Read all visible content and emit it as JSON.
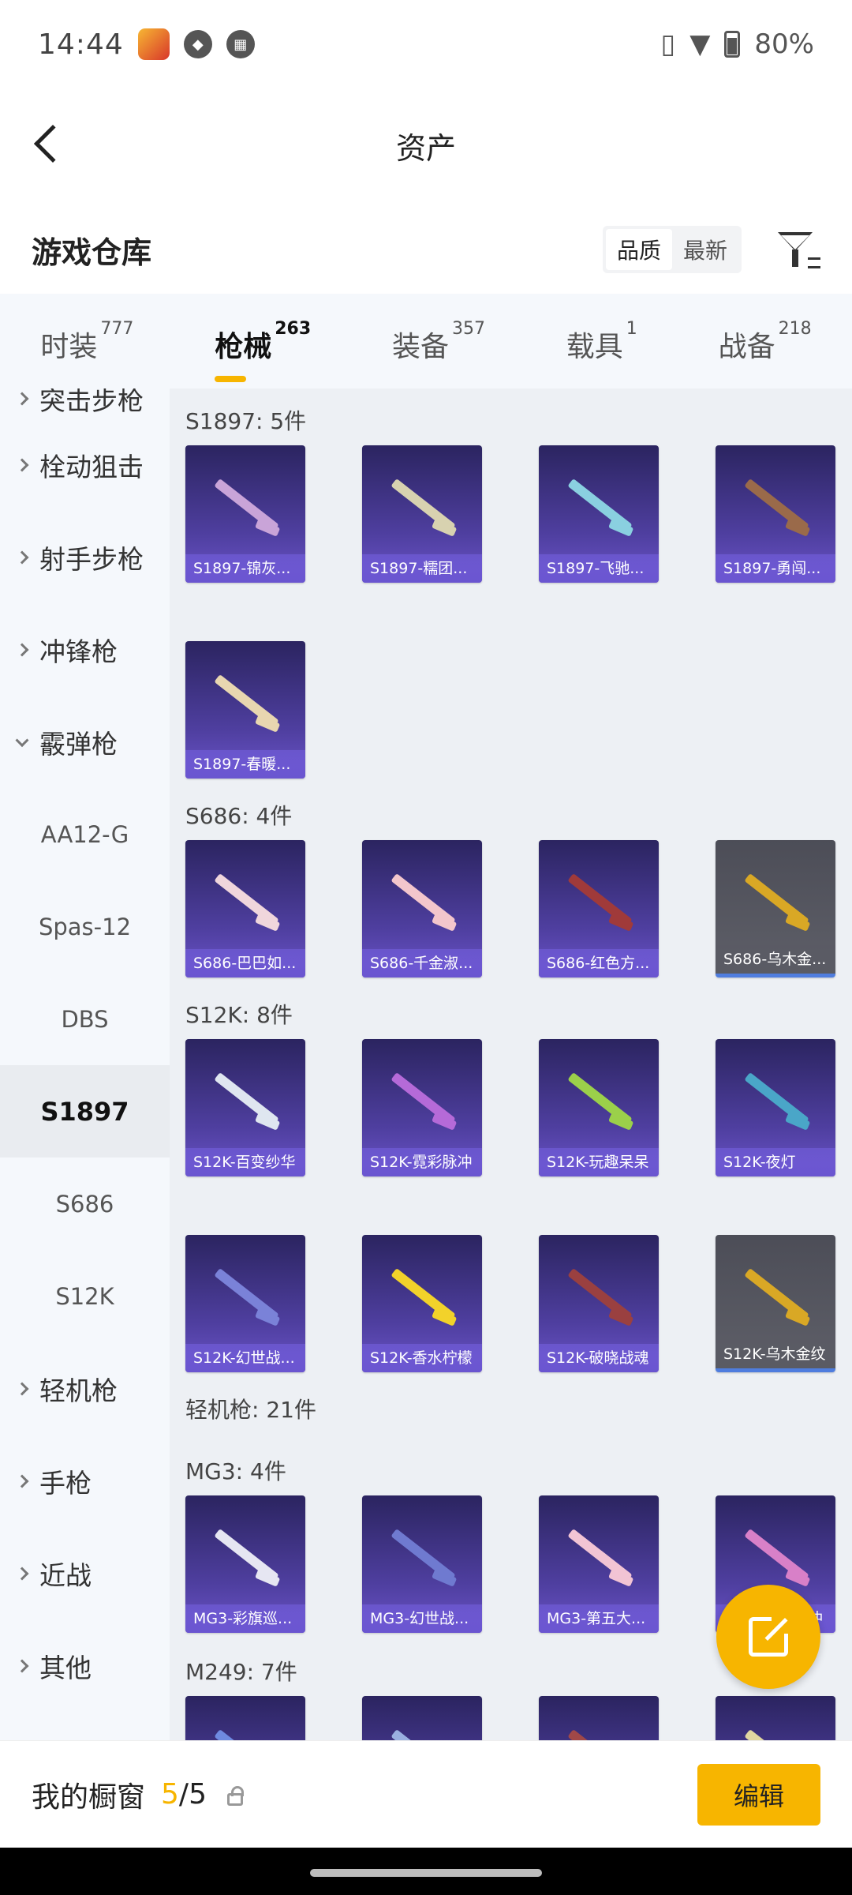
{
  "status_bar": {
    "time": "14:44",
    "battery": "80%"
  },
  "header": {
    "title": "资产"
  },
  "warehouse": {
    "title": "游戏仓库",
    "sort_options": [
      "品质",
      "最新"
    ]
  },
  "tabs": [
    {
      "label": "时装",
      "count": "777"
    },
    {
      "label": "枪械",
      "count": "263"
    },
    {
      "label": "装备",
      "count": "357"
    },
    {
      "label": "载具",
      "count": "1"
    },
    {
      "label": "战备",
      "count": "218"
    }
  ],
  "sidebar": {
    "items": [
      {
        "label": "突击步枪"
      },
      {
        "label": "栓动狙击"
      },
      {
        "label": "射手步枪"
      },
      {
        "label": "冲锋枪"
      },
      {
        "label": "霰弹枪"
      },
      {
        "label": "AA12-G"
      },
      {
        "label": "Spas-12"
      },
      {
        "label": "DBS"
      },
      {
        "label": "S1897"
      },
      {
        "label": "S686"
      },
      {
        "label": "S12K"
      },
      {
        "label": "轻机枪"
      },
      {
        "label": "手枪"
      },
      {
        "label": "近战"
      },
      {
        "label": "其他"
      }
    ]
  },
  "groups": [
    {
      "label": "S1897: 5件",
      "items": [
        {
          "name": "S1897-锦灰...",
          "color": "#c9a4d8"
        },
        {
          "name": "S1897-糯团...",
          "color": "#d8d2b0"
        },
        {
          "name": "S1897-飞驰...",
          "color": "#8ad0e0"
        },
        {
          "name": "S1897-勇闯...",
          "color": "#9a6a4a"
        },
        {
          "name": "S1897-春暖...",
          "color": "#e8d6b0"
        }
      ]
    },
    {
      "label": "S686: 4件",
      "items": [
        {
          "name": "S686-巴巴如...",
          "color": "#f0d6dc"
        },
        {
          "name": "S686-千金淑...",
          "color": "#f3c6cc"
        },
        {
          "name": "S686-红色方...",
          "color": "#a03a3a"
        },
        {
          "name": "S686-乌木金...",
          "color": "#d9a825"
        }
      ]
    },
    {
      "label": "S12K: 8件",
      "items": [
        {
          "name": "S12K-百变纱华",
          "color": "#dfe6f0"
        },
        {
          "name": "S12K-霓彩脉冲",
          "color": "#b56ad8"
        },
        {
          "name": "S12K-玩趣呆呆",
          "color": "#9bd04a"
        },
        {
          "name": "S12K-夜灯",
          "color": "#4aa6c8"
        },
        {
          "name": "S12K-幻世战...",
          "color": "#7a82d8"
        },
        {
          "name": "S12K-香水柠檬",
          "color": "#f2d22a"
        },
        {
          "name": "S12K-破晓战魂",
          "color": "#9a4040"
        },
        {
          "name": "S12K-乌木金纹",
          "color": "#d9a825"
        }
      ]
    },
    {
      "label": "轻机枪: 21件",
      "items": []
    },
    {
      "label": "MG3: 4件",
      "items": [
        {
          "name": "MG3-彩旗巡...",
          "color": "#e6e6f2"
        },
        {
          "name": "MG3-幻世战...",
          "color": "#6f7ad0"
        },
        {
          "name": "MG3-第五大...",
          "color": "#f2c4d4"
        },
        {
          "name": "MG3-霓彩脉冲",
          "color": "#d880c8"
        }
      ]
    },
    {
      "label": "M249: 7件",
      "items": [
        {
          "name": "",
          "color": "#6f8ae0"
        },
        {
          "name": "",
          "color": "#9ab0e0"
        },
        {
          "name": "",
          "color": "#a04848"
        },
        {
          "name": "",
          "color": "#e0d6a0"
        }
      ]
    }
  ],
  "bottom_bar": {
    "label": "我的橱窗",
    "current": "5",
    "separator": "/",
    "total": "5",
    "edit_label": "编辑"
  }
}
